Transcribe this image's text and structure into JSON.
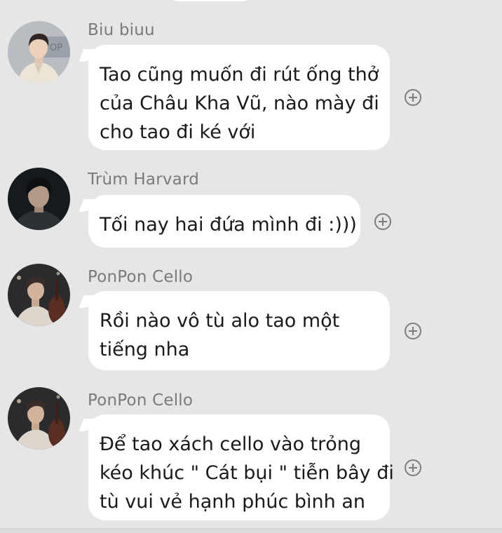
{
  "messages": [
    {
      "sender": "Biu biuu",
      "avatar": "avatar-man-beige-suit",
      "lines": [
        "Tao cũng muốn đi rút ống thở",
        "của Châu Kha Vũ, nào mày đi",
        "cho tao đi ké với"
      ]
    },
    {
      "sender": "Trùm Harvard",
      "avatar": "avatar-man-dark-hair",
      "lines": [
        "Tối nay hai đứa mình đi :)))"
      ]
    },
    {
      "sender": "PonPon Cello",
      "avatar": "avatar-cello-player",
      "lines": [
        "Rồi nào vô tù alo tao một",
        "tiếng nha"
      ]
    },
    {
      "sender": "PonPon Cello",
      "avatar": "avatar-cello-player",
      "lines": [
        "Để tao xách cello vào trỏng",
        "kéo khúc \" Cát bụi \" tiễn bây đi",
        "tù vui vẻ hạnh phúc bình an"
      ]
    }
  ],
  "icons": {
    "react_button": "add-reaction-icon"
  },
  "colors": {
    "background": "#e6e6e6",
    "bubble": "#ffffff",
    "text": "#1a1a1a",
    "sender": "#7a7a7a",
    "icon": "#7d7d7d"
  }
}
